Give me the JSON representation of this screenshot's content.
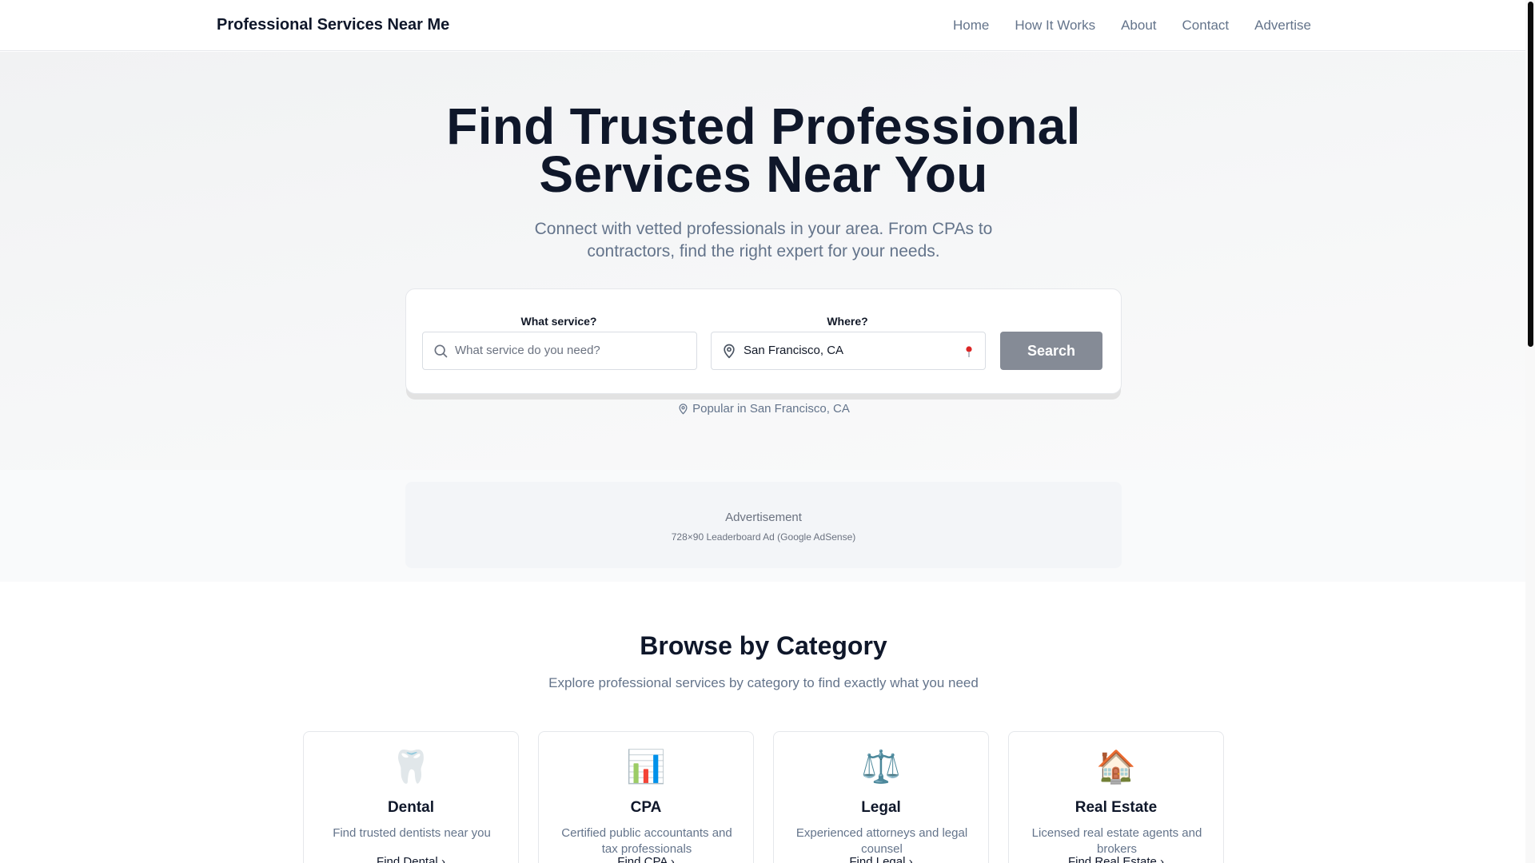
{
  "header": {
    "brand": "Professional Services Near Me",
    "nav": [
      "Home",
      "How It Works",
      "About",
      "Contact",
      "Advertise"
    ]
  },
  "hero": {
    "title_line1": "Find Trusted Professional",
    "title_line2": "Services Near You",
    "subtitle": "Connect with vetted professionals in your area. From CPAs to contractors, find the right expert for your needs.",
    "search": {
      "service_label": "What service?",
      "service_placeholder": "What service do you need?",
      "location_label": "Where?",
      "location_value": "San Francisco, CA",
      "button": "Search"
    },
    "popular": "Popular in San Francisco, CA"
  },
  "ad": {
    "title": "Advertisement",
    "subtitle": "728×90 Leaderboard Ad (Google AdSense)"
  },
  "categories": {
    "title": "Browse by Category",
    "subtitle": "Explore professional services by category to find exactly what you need",
    "items": [
      {
        "icon": "tooth-icon",
        "emoji": "🦷",
        "name": "Dental",
        "desc": "Find trusted dentists near you",
        "link": "Find Dental"
      },
      {
        "icon": "bar-chart-icon",
        "emoji": "📊",
        "name": "CPA",
        "desc": "Certified public accountants and tax professionals",
        "link": "Find CPA"
      },
      {
        "icon": "scales-icon",
        "emoji": "⚖️",
        "name": "Legal",
        "desc": "Experienced attorneys and legal counsel",
        "link": "Find Legal"
      },
      {
        "icon": "house-icon",
        "emoji": "🏠",
        "name": "Real Estate",
        "desc": "Licensed real estate agents and brokers",
        "link": "Find Real Estate"
      }
    ]
  },
  "colors": {
    "brand_text": "#0f172a",
    "muted_text": "#64748b",
    "search_button": "#858b96",
    "location_pin": "#dc2626"
  }
}
